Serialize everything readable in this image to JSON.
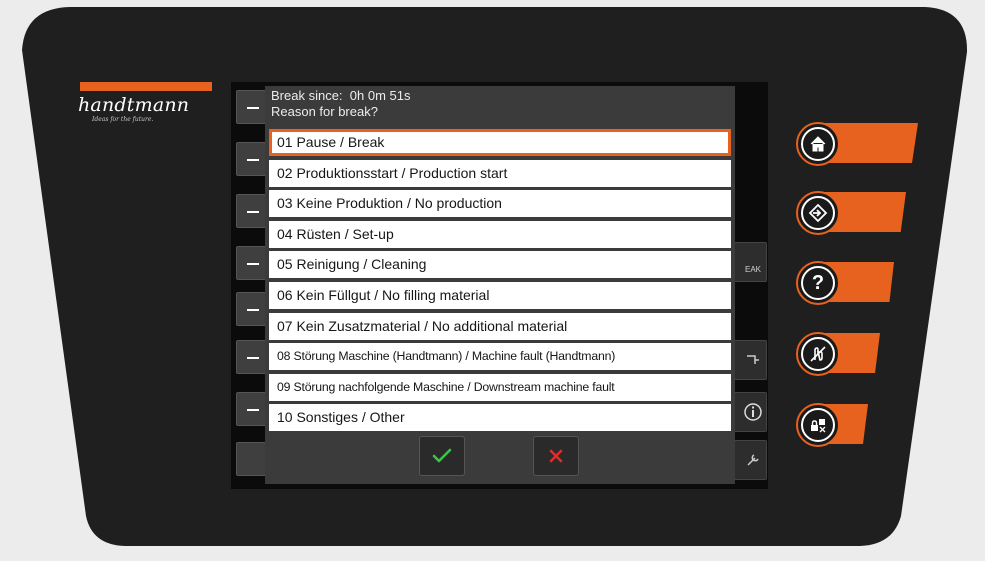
{
  "brand": {
    "name": "handtmann",
    "tagline": "Ideas for the future."
  },
  "dialog": {
    "break_since_label": "Break since:",
    "break_since_value": "0h 0m 51s",
    "question": "Reason for break?",
    "reasons": [
      "01  Pause / Break",
      "02  Produktionsstart / Production start",
      "03  Keine Produktion / No production",
      "04  Rüsten / Set-up",
      "05  Reinigung / Cleaning",
      "06  Kein Füllgut / No filling material",
      "07  Kein Zusatzmaterial  / No additional material",
      "08  Störung Maschine (Handtmann) / Machine fault (Handtmann)",
      "09  Störung nachfolgende Maschine / Downstream machine fault",
      "10  Sonstiges / Other"
    ],
    "selected_index": 0,
    "confirm_icon": "check-icon",
    "cancel_icon": "x-icon"
  },
  "background_screen": {
    "right_label": "EAK"
  },
  "hardware_buttons": [
    "home-icon",
    "machine-icon",
    "help-icon",
    "hand-pause-icon",
    "lock-icon"
  ],
  "hardware_help_glyph": "?",
  "colors": {
    "accent": "#e8621f",
    "panel": "#1e1e1e",
    "dialog": "#3b3b3b",
    "confirm": "#3cc44a",
    "cancel": "#e32a2a"
  }
}
